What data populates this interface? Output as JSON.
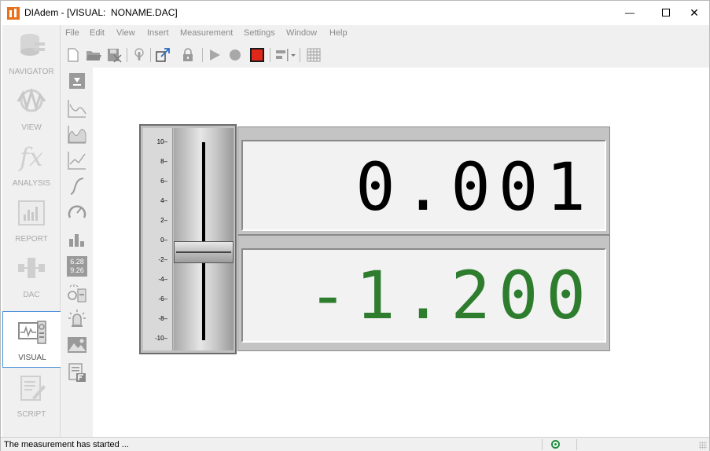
{
  "window": {
    "title": "DIAdem - [VISUAL:  NONAME.DAC]",
    "minimize_glyph": "—",
    "close_glyph": "✕"
  },
  "menu": {
    "items": [
      "File",
      "Edit",
      "View",
      "Insert",
      "Measurement",
      "Settings",
      "Window",
      "Help"
    ]
  },
  "toolbar": {
    "icons": [
      "new-file-icon",
      "open-folder-icon",
      "save-icon",
      "touch-icon",
      "export-icon",
      "lock-icon",
      "play-icon",
      "record-icon",
      "stop-icon",
      "align-icon",
      "dropdown-arrow-icon",
      "grid-icon"
    ],
    "stop_color": "#e0281a"
  },
  "navigator": {
    "items": [
      {
        "label": "NAVIGATOR",
        "icon": "navigator-icon"
      },
      {
        "label": "VIEW",
        "icon": "view-icon"
      },
      {
        "label": "ANALYSIS",
        "icon": "analysis-fx-icon"
      },
      {
        "label": "REPORT",
        "icon": "report-icon"
      },
      {
        "label": "DAC",
        "icon": "dac-icon"
      },
      {
        "label": "VISUAL",
        "icon": "visual-icon",
        "active": true
      },
      {
        "label": "SCRIPT",
        "icon": "script-icon"
      }
    ],
    "fx_text": "fx"
  },
  "palette": {
    "icons": [
      "download-icon",
      "chart-line-icon",
      "chart-area-icon",
      "chart-xy-icon",
      "curve-icon",
      "gauge-icon",
      "bar-chart-icon",
      "digital-display-icon",
      "slider-icon",
      "alarm-icon",
      "image-icon",
      "text-box-icon"
    ],
    "digital_display_top": "6.28",
    "digital_display_bottom": "9.26"
  },
  "slider": {
    "scale_labels": [
      "10",
      "8",
      "6",
      "4",
      "2",
      "0",
      "-2",
      "-4",
      "-6",
      "-8",
      "-10"
    ],
    "min": -10,
    "max": 10,
    "value": -1.2
  },
  "displays": [
    {
      "value": "0.001",
      "color": "#000000"
    },
    {
      "value": "-1.200",
      "color": "#2e7d2e"
    }
  ],
  "status": {
    "message": "The measurement has started ...",
    "led_color": "#1e8c3a"
  }
}
